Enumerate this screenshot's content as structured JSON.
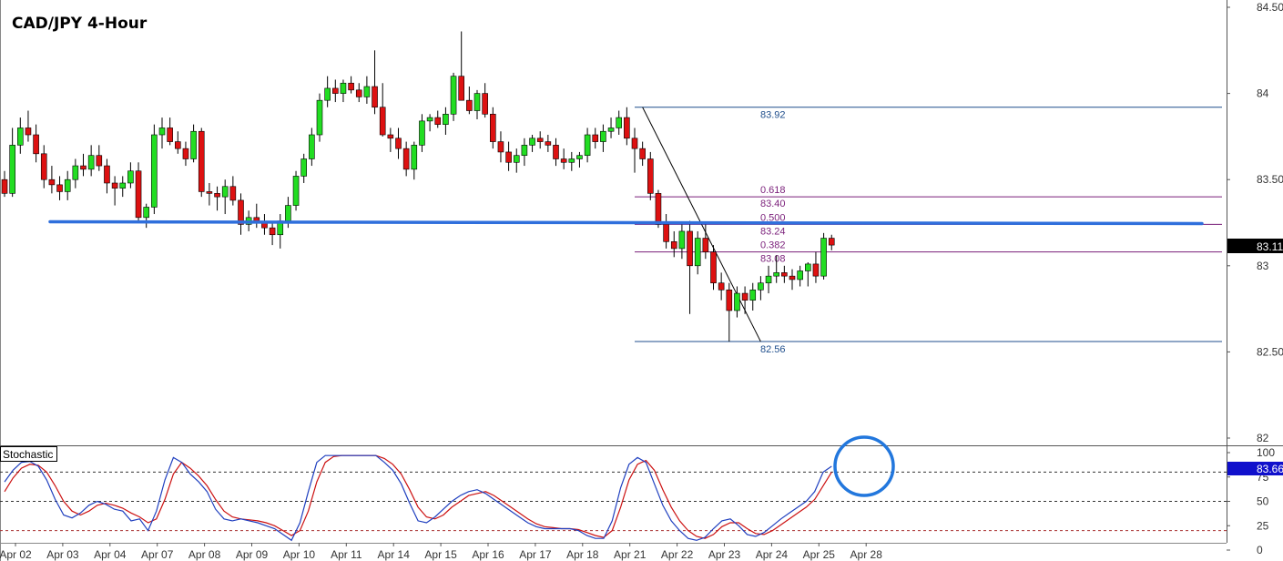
{
  "title": "CAD/JPY 4-Hour",
  "colors": {
    "up": "#22dd22",
    "down": "#dd1111",
    "support": "#2f6fdc",
    "fib_level": "#7a1f7a",
    "swing": "#1f4e8c",
    "stoch_k": "#1f3fbf",
    "stoch_d": "#cc1111",
    "highlight_circle": "#2277dd",
    "price_badge": "#000000",
    "stoch_badge": "#1010cc"
  },
  "chart_data": {
    "type": "candlestick",
    "title": "CAD/JPY 4-Hour",
    "ylim": [
      81.95,
      84.52
    ],
    "y_ticks": [
      "84.50",
      "84",
      "83.50",
      "83",
      "82.50",
      "82"
    ],
    "y_tick_values": [
      84.5,
      84.0,
      83.5,
      83.0,
      82.5,
      82.0
    ],
    "x_tick_labels": [
      "Apr 02",
      "Apr 03",
      "Apr 04",
      "Apr 07",
      "Apr 08",
      "Apr 09",
      "Apr 10",
      "Apr 11",
      "Apr 14",
      "Apr 15",
      "Apr 16",
      "Apr 17",
      "Apr 18",
      "Apr 21",
      "Apr 22",
      "Apr 23",
      "Apr 24",
      "Apr 25",
      "Apr 28"
    ],
    "x_tick_index": [
      0,
      6,
      12,
      18,
      24,
      30,
      36,
      42,
      48,
      54,
      60,
      66,
      72,
      78,
      84,
      90,
      96,
      102,
      108
    ],
    "candles": [
      [
        83.5,
        83.55,
        83.4,
        83.42
      ],
      [
        83.42,
        83.8,
        83.4,
        83.7
      ],
      [
        83.7,
        83.86,
        83.65,
        83.8
      ],
      [
        83.8,
        83.9,
        83.72,
        83.76
      ],
      [
        83.76,
        83.82,
        83.6,
        83.65
      ],
      [
        83.65,
        83.7,
        83.45,
        83.5
      ],
      [
        83.5,
        83.58,
        83.42,
        83.47
      ],
      [
        83.47,
        83.52,
        83.38,
        83.43
      ],
      [
        83.43,
        83.55,
        83.38,
        83.5
      ],
      [
        83.5,
        83.62,
        83.45,
        83.58
      ],
      [
        83.58,
        83.65,
        83.52,
        83.56
      ],
      [
        83.56,
        83.7,
        83.52,
        83.64
      ],
      [
        83.64,
        83.7,
        83.55,
        83.58
      ],
      [
        83.58,
        83.62,
        83.42,
        83.48
      ],
      [
        83.48,
        83.52,
        83.35,
        83.45
      ],
      [
        83.45,
        83.52,
        83.4,
        83.48
      ],
      [
        83.48,
        83.6,
        83.45,
        83.55
      ],
      [
        83.55,
        83.6,
        83.25,
        83.28
      ],
      [
        83.28,
        83.36,
        83.22,
        83.34
      ],
      [
        83.34,
        83.82,
        83.3,
        83.76
      ],
      [
        83.76,
        83.86,
        83.68,
        83.8
      ],
      [
        83.8,
        83.86,
        83.7,
        83.72
      ],
      [
        83.72,
        83.78,
        83.65,
        83.68
      ],
      [
        83.68,
        83.72,
        83.58,
        83.62
      ],
      [
        83.62,
        83.82,
        83.6,
        83.78
      ],
      [
        83.78,
        83.8,
        83.4,
        83.43
      ],
      [
        83.43,
        83.48,
        83.35,
        83.42
      ],
      [
        83.42,
        83.46,
        83.32,
        83.4
      ],
      [
        83.4,
        83.5,
        83.3,
        83.46
      ],
      [
        83.46,
        83.52,
        83.35,
        83.38
      ],
      [
        83.38,
        83.42,
        83.18,
        83.24
      ],
      [
        83.24,
        83.32,
        83.2,
        83.28
      ],
      [
        83.28,
        83.36,
        83.22,
        83.25
      ],
      [
        83.25,
        83.3,
        83.18,
        83.22
      ],
      [
        83.22,
        83.26,
        83.12,
        83.18
      ],
      [
        83.18,
        83.3,
        83.1,
        83.26
      ],
      [
        83.26,
        83.4,
        83.22,
        83.35
      ],
      [
        83.35,
        83.55,
        83.32,
        83.52
      ],
      [
        83.52,
        83.65,
        83.48,
        83.62
      ],
      [
        83.62,
        83.8,
        83.58,
        83.76
      ],
      [
        83.76,
        84.0,
        83.72,
        83.96
      ],
      [
        83.96,
        84.1,
        83.92,
        84.03
      ],
      [
        84.03,
        84.08,
        83.95,
        84.0
      ],
      [
        84.0,
        84.08,
        83.95,
        84.06
      ],
      [
        84.06,
        84.1,
        84.0,
        84.02
      ],
      [
        84.02,
        84.06,
        83.95,
        83.98
      ],
      [
        83.98,
        84.1,
        83.94,
        84.04
      ],
      [
        84.04,
        84.25,
        83.88,
        83.92
      ],
      [
        83.92,
        84.06,
        83.75,
        83.76
      ],
      [
        83.76,
        83.8,
        83.66,
        83.74
      ],
      [
        83.74,
        83.8,
        83.62,
        83.68
      ],
      [
        83.68,
        83.72,
        83.52,
        83.56
      ],
      [
        83.56,
        83.72,
        83.5,
        83.7
      ],
      [
        83.7,
        83.88,
        83.66,
        83.84
      ],
      [
        83.84,
        83.88,
        83.78,
        83.86
      ],
      [
        83.86,
        83.9,
        83.8,
        83.82
      ],
      [
        83.82,
        83.92,
        83.76,
        83.88
      ],
      [
        83.88,
        84.12,
        83.84,
        84.1
      ],
      [
        84.1,
        84.36,
        83.98,
        83.96
      ],
      [
        83.96,
        84.04,
        83.88,
        83.9
      ],
      [
        83.9,
        84.02,
        83.85,
        84.0
      ],
      [
        84.0,
        84.06,
        83.86,
        83.88
      ],
      [
        83.88,
        83.92,
        83.68,
        83.72
      ],
      [
        83.72,
        83.78,
        83.6,
        83.66
      ],
      [
        83.66,
        83.72,
        83.55,
        83.6
      ],
      [
        83.6,
        83.68,
        83.54,
        83.64
      ],
      [
        83.64,
        83.74,
        83.58,
        83.7
      ],
      [
        83.7,
        83.76,
        83.66,
        83.74
      ],
      [
        83.74,
        83.78,
        83.68,
        83.72
      ],
      [
        83.72,
        83.76,
        83.66,
        83.7
      ],
      [
        83.7,
        83.74,
        83.58,
        83.62
      ],
      [
        83.62,
        83.68,
        83.56,
        83.6
      ],
      [
        83.6,
        83.66,
        83.55,
        83.62
      ],
      [
        83.62,
        83.66,
        83.57,
        83.64
      ],
      [
        83.64,
        83.8,
        83.6,
        83.76
      ],
      [
        83.76,
        83.8,
        83.68,
        83.72
      ],
      [
        83.72,
        83.82,
        83.66,
        83.78
      ],
      [
        83.78,
        83.86,
        83.74,
        83.8
      ],
      [
        83.8,
        83.9,
        83.76,
        83.86
      ],
      [
        83.86,
        83.92,
        83.7,
        83.74
      ],
      [
        83.74,
        83.8,
        83.54,
        83.68
      ],
      [
        83.68,
        83.72,
        83.58,
        83.62
      ],
      [
        83.62,
        83.66,
        83.38,
        83.42
      ],
      [
        83.42,
        83.44,
        83.22,
        83.24
      ],
      [
        83.24,
        83.3,
        83.1,
        83.14
      ],
      [
        83.14,
        83.2,
        83.05,
        83.1
      ],
      [
        83.1,
        83.24,
        83.04,
        83.2
      ],
      [
        83.2,
        83.26,
        82.72,
        83.0
      ],
      [
        83.0,
        83.2,
        82.95,
        83.16
      ],
      [
        83.16,
        83.24,
        83.04,
        83.08
      ],
      [
        83.08,
        83.12,
        82.86,
        82.9
      ],
      [
        82.9,
        82.96,
        82.8,
        82.86
      ],
      [
        82.86,
        82.9,
        82.56,
        82.74
      ],
      [
        82.74,
        82.88,
        82.7,
        82.84
      ],
      [
        82.84,
        82.88,
        82.72,
        82.8
      ],
      [
        82.8,
        82.9,
        82.74,
        82.86
      ],
      [
        82.86,
        82.94,
        82.8,
        82.9
      ],
      [
        82.9,
        83.0,
        82.84,
        82.94
      ],
      [
        82.94,
        83.06,
        82.9,
        82.96
      ],
      [
        82.96,
        83.0,
        82.9,
        82.94
      ],
      [
        82.94,
        82.98,
        82.86,
        82.92
      ],
      [
        82.92,
        83.0,
        82.88,
        82.97
      ],
      [
        82.97,
        83.02,
        82.88,
        83.01
      ],
      [
        83.01,
        83.08,
        82.9,
        82.94
      ],
      [
        82.94,
        83.19,
        82.92,
        83.16
      ],
      [
        83.16,
        83.18,
        83.09,
        83.12
      ]
    ],
    "horizontal_levels": [
      {
        "label": "83.92",
        "value": 83.92,
        "kind": "swing-high"
      },
      {
        "label": "83.40",
        "value": 83.4,
        "ratio": "0.618",
        "kind": "fib"
      },
      {
        "label": "83.24",
        "value": 83.24,
        "ratio": "0.500",
        "kind": "fib"
      },
      {
        "label": "83.08",
        "value": 83.08,
        "ratio": "0.382",
        "kind": "fib"
      },
      {
        "label": "82.56",
        "value": 82.56,
        "kind": "swing-low"
      }
    ],
    "support_line": {
      "value": 83.25,
      "from_index": 4,
      "to_index": 143
    },
    "swing_line": {
      "from": {
        "index": 81,
        "value": 83.92
      },
      "to": {
        "index": 96,
        "value": 82.56
      }
    },
    "current_price": "83.11",
    "stochastic": {
      "label": "Stochastic",
      "ylim": [
        0,
        100
      ],
      "y_ticks": [
        "100",
        "75",
        "50",
        "25",
        "0"
      ],
      "levels": [
        80,
        50,
        20
      ],
      "current_value": "83.66",
      "k": [
        70,
        82,
        90,
        91,
        86,
        72,
        52,
        36,
        33,
        38,
        46,
        50,
        47,
        42,
        40,
        30,
        32,
        20,
        40,
        72,
        95,
        90,
        78,
        70,
        60,
        42,
        32,
        30,
        32,
        30,
        28,
        25,
        22,
        16,
        10,
        28,
        60,
        90,
        97,
        97,
        97,
        97,
        97,
        97,
        97,
        90,
        82,
        68,
        48,
        30,
        28,
        34,
        42,
        50,
        56,
        60,
        62,
        58,
        52,
        46,
        40,
        34,
        28,
        24,
        22,
        22,
        22,
        22,
        20,
        15,
        12,
        12,
        30,
        64,
        88,
        95,
        90,
        68,
        46,
        30,
        20,
        12,
        10,
        13,
        22,
        30,
        32,
        25,
        16,
        14,
        18,
        25,
        32,
        38,
        44,
        50,
        60,
        80,
        86
      ],
      "d": [
        60,
        74,
        84,
        88,
        87,
        80,
        66,
        50,
        40,
        36,
        40,
        46,
        48,
        46,
        43,
        38,
        34,
        28,
        32,
        52,
        78,
        90,
        84,
        76,
        66,
        52,
        40,
        34,
        32,
        31,
        30,
        28,
        25,
        20,
        15,
        20,
        40,
        70,
        90,
        96,
        97,
        97,
        97,
        97,
        97,
        94,
        88,
        78,
        62,
        44,
        34,
        32,
        36,
        44,
        50,
        56,
        58,
        60,
        56,
        50,
        44,
        38,
        32,
        27,
        24,
        23,
        22,
        22,
        21,
        18,
        15,
        13,
        20,
        44,
        72,
        88,
        92,
        82,
        62,
        44,
        30,
        20,
        14,
        12,
        16,
        24,
        28,
        28,
        22,
        17,
        16,
        20,
        26,
        32,
        38,
        44,
        52,
        66,
        80
      ],
      "k_start_index": 0
    }
  }
}
